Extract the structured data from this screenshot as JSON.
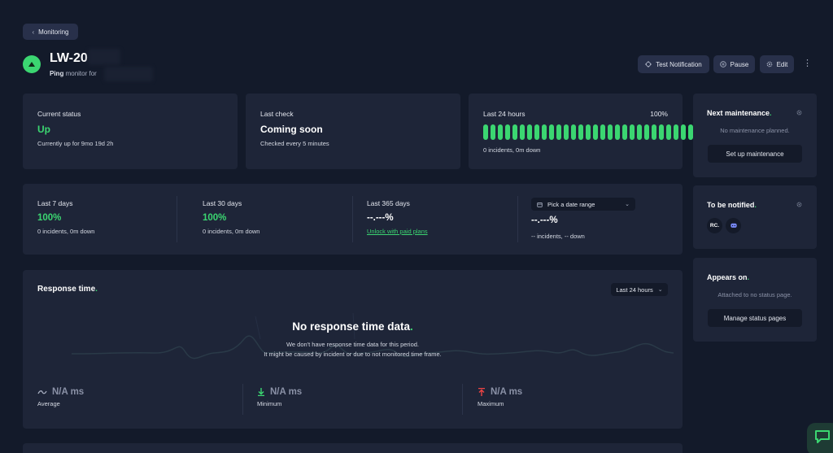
{
  "breadcrumb": {
    "back_label": "Monitoring"
  },
  "monitor": {
    "name": "LW-20",
    "type_label": "Ping",
    "subtitle": "monitor for"
  },
  "actions": {
    "test_notification": "Test Notification",
    "pause": "Pause",
    "edit": "Edit",
    "more": "⋮"
  },
  "status_card": {
    "label": "Current status",
    "value": "Up",
    "detail": "Currently up for 9mo 19d 2h"
  },
  "check_card": {
    "label": "Last check",
    "value": "Coming soon",
    "detail": "Checked every 5 minutes"
  },
  "uptime24": {
    "label": "Last 24 hours",
    "percent": "100%",
    "detail": "0 incidents, 0m down",
    "bar_count": 30
  },
  "periods": [
    {
      "label": "Last 7 days",
      "value": "100%",
      "detail": "0 incidents, 0m down"
    },
    {
      "label": "Last 30 days",
      "value": "100%",
      "detail": "0 incidents, 0m down"
    },
    {
      "label": "Last 365 days",
      "value": "--.---%",
      "link": "Unlock with paid plans"
    },
    {
      "label": "Pick a date range",
      "value": "--.---%",
      "detail": "-- incidents, -- down"
    }
  ],
  "response": {
    "title": "Response time",
    "range_select": "Last 24 hours",
    "empty_title": "No response time data",
    "empty_line1": "We don't have response time data for this period.",
    "empty_line2": "It might be caused by incident or due to not monitored time frame.",
    "stats": [
      {
        "value": "N/A ms",
        "label": "Average",
        "icon": "average-icon"
      },
      {
        "value": "N/A ms",
        "label": "Minimum",
        "icon": "arrow-down-icon"
      },
      {
        "value": "N/A ms",
        "label": "Maximum",
        "icon": "arrow-up-icon"
      }
    ]
  },
  "maintenance": {
    "title": "Next maintenance",
    "empty": "No maintenance planned.",
    "button": "Set up maintenance"
  },
  "notified": {
    "title": "To be notified",
    "avatar_initials": "RC"
  },
  "appears": {
    "title": "Appears on",
    "empty": "Attached to no status page.",
    "button": "Manage status pages"
  },
  "dot": ".",
  "colors": {
    "background": "#131a2a",
    "card": "#1e2538",
    "accent_green": "#3bd671",
    "button": "#28304a"
  }
}
